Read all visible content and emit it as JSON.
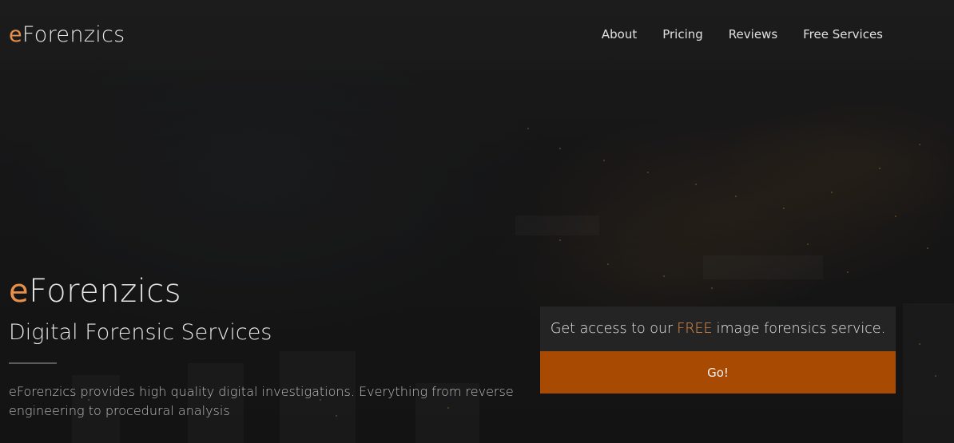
{
  "brand": {
    "accent_letter": "e",
    "rest": "Forenzics"
  },
  "nav": {
    "links": [
      "About",
      "Pricing",
      "Reviews",
      "Free Services"
    ]
  },
  "hero": {
    "title_accent": "e",
    "title_rest": "Forenzics",
    "subtitle": "Digital Forensic Services",
    "description": "eForenzics provides high quality digital investigations. Everything from reverse engineering to procedural analysis"
  },
  "cta": {
    "text_before": "Get access to our",
    "text_highlight": "FREE",
    "text_after": "image forensics service.",
    "button_label": "Go!"
  },
  "colors": {
    "accent": "#e8904a",
    "button_bg": "#a94a02",
    "background": "#1b1b1b"
  }
}
